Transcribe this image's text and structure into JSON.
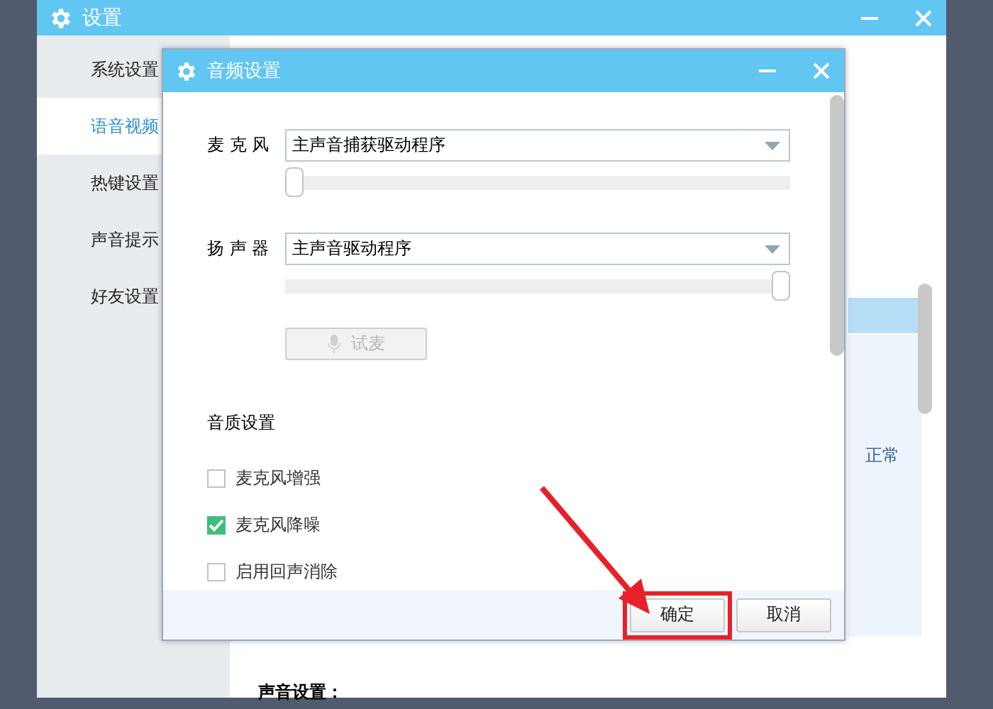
{
  "main_window": {
    "title": "设置",
    "sidebar": {
      "items": [
        {
          "label": "系统设置",
          "selected": false
        },
        {
          "label": "语音视频",
          "selected": true
        },
        {
          "label": "热键设置",
          "selected": false
        },
        {
          "label": "声音提示",
          "selected": false
        },
        {
          "label": "好友设置",
          "selected": false
        }
      ]
    },
    "table_cell": "正常",
    "section_heading": "声音设置："
  },
  "dialog": {
    "title": "音频设置",
    "devices": [
      {
        "label": "麦 克 风",
        "value": "主声音捕获驱动程序",
        "level": 0
      },
      {
        "label": "扬 声 器",
        "value": "主声音驱动程序",
        "level": 1
      }
    ],
    "test_button": {
      "label": "试麦",
      "disabled": true
    },
    "quality_heading": "音质设置",
    "options": [
      {
        "label": "麦克风增强",
        "checked": false
      },
      {
        "label": "麦克风降噪",
        "checked": true
      },
      {
        "label": "启用回声消除",
        "checked": false
      }
    ],
    "buttons": [
      {
        "label": "确定",
        "highlighted": true
      },
      {
        "label": "取消",
        "highlighted": false
      }
    ]
  }
}
